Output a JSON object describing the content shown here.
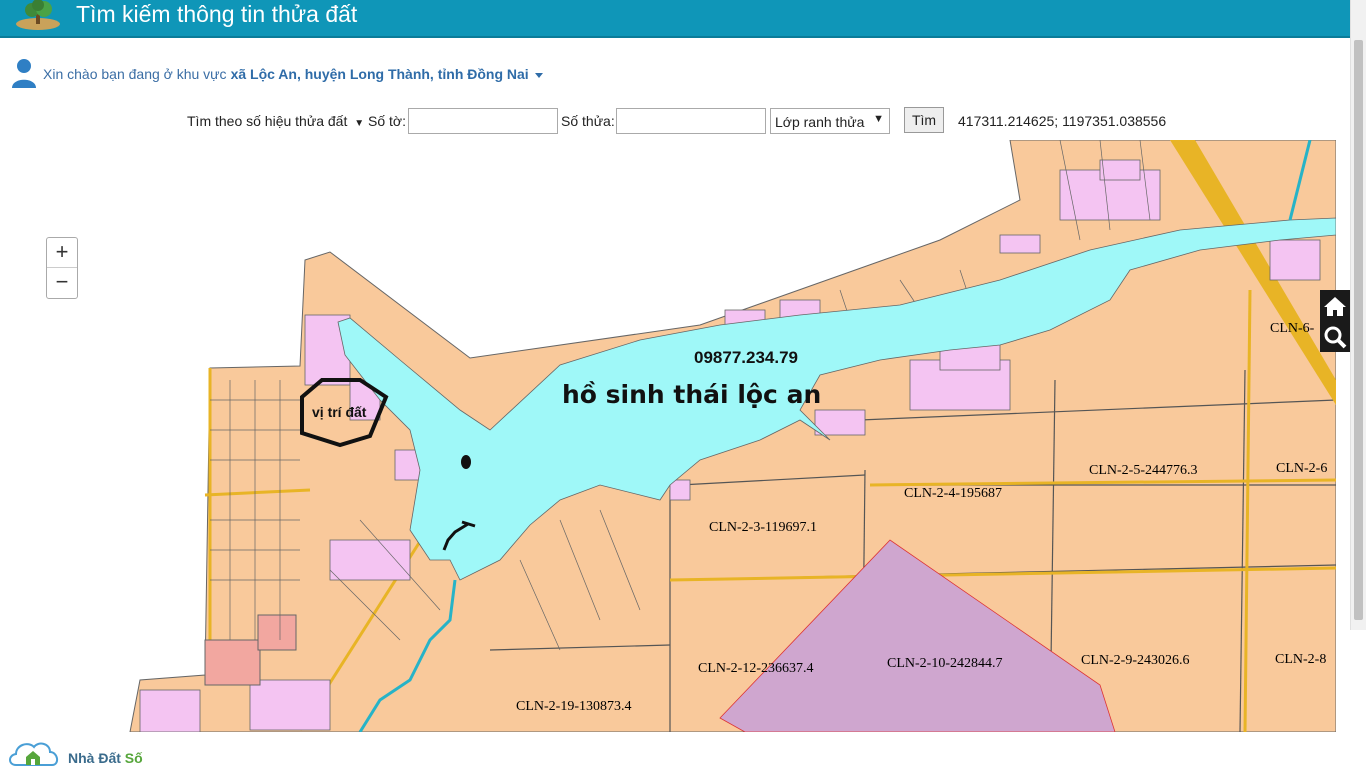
{
  "app": {
    "title": "Tìm kiếm thông tin thửa đất"
  },
  "greeting": {
    "prefix": "Xin chào bạn đang ở khu vực",
    "region": "xã Lộc An, huyện Long Thành, tỉnh Đồng Nai"
  },
  "search": {
    "mode_label": "Tìm theo số hiệu thửa đất",
    "so_to_label": "Số tờ:",
    "so_to_value": "",
    "so_thua_label": "Số thửa:",
    "so_thua_value": "",
    "layer_selected": "Lớp ranh thửa",
    "find_button": "Tìm",
    "coordinates": "417311.214625; 1197351.038556"
  },
  "map": {
    "zoom_in": "+",
    "zoom_out": "−",
    "annotations": {
      "phone": "09877.234.79",
      "lake": "hồ sinh thái lộc an",
      "location": "vị trí đất"
    },
    "parcel_labels": [
      "CLN-6-",
      "CLN-2-4-195687",
      "CLN-2-5-244776.3",
      "CLN-2-6",
      "CLN-2-3-119697.1",
      "CLN-2-12-236637.4",
      "CLN-2-10-242844.7",
      "CLN-2-9-243026.6",
      "CLN-2-8",
      "CLN-2-19-130873.4"
    ],
    "colors": {
      "land": "#f9c99b",
      "residential": "#f4c4f2",
      "water": "#9ff8f8",
      "purple_zone": "#cfa6cf",
      "road": "#e8b426",
      "pink_zone": "#f2a7a0",
      "parcel_line": "#555555"
    }
  },
  "side_tools": {
    "home": "home-icon",
    "search": "search-icon"
  },
  "footer": {
    "brand_a": "Nhà Đất ",
    "brand_b": "Số"
  }
}
